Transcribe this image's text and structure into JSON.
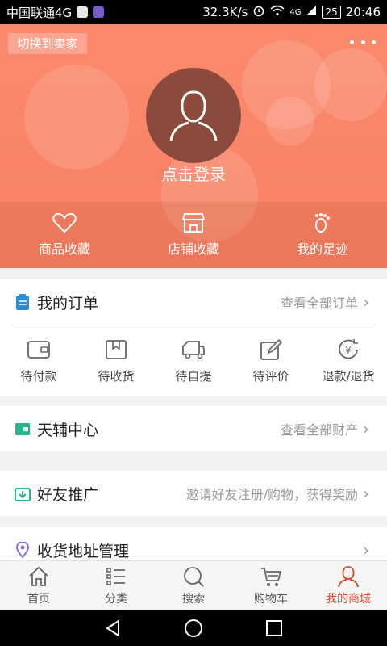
{
  "status_bar": {
    "carrier": "中国联通4G",
    "speed": "32.3K/s",
    "network": "4G",
    "battery": "25",
    "time": "20:46"
  },
  "header": {
    "switch_label": "切换到卖家",
    "login_label": "点击登录",
    "favorites": [
      {
        "label": "商品收藏",
        "icon": "heart-icon"
      },
      {
        "label": "店铺收藏",
        "icon": "store-icon"
      },
      {
        "label": "我的足迹",
        "icon": "footprint-icon"
      }
    ]
  },
  "orders_card": {
    "title": "我的订单",
    "link": "查看全部订单",
    "items": [
      {
        "label": "待付款",
        "icon": "wallet-icon"
      },
      {
        "label": "待收货",
        "icon": "package-icon"
      },
      {
        "label": "待自提",
        "icon": "truck-icon"
      },
      {
        "label": "待评价",
        "icon": "edit-icon"
      },
      {
        "label": "退款/退货",
        "icon": "refund-icon"
      }
    ]
  },
  "tianfu_card": {
    "title": "天辅中心",
    "link": "查看全部财产"
  },
  "invite_card": {
    "title": "好友推广",
    "link": "邀请好友注册/购物，获得奖励"
  },
  "address_card": {
    "title": "收货地址管理"
  },
  "bottom_nav": [
    {
      "label": "首页",
      "icon": "home-icon"
    },
    {
      "label": "分类",
      "icon": "list-icon"
    },
    {
      "label": "搜索",
      "icon": "search-icon"
    },
    {
      "label": "购物车",
      "icon": "cart-icon"
    },
    {
      "label": "我的商城",
      "icon": "person-icon",
      "active": true
    }
  ],
  "colors": {
    "accent": "#e2482a",
    "header": "#f78064"
  }
}
